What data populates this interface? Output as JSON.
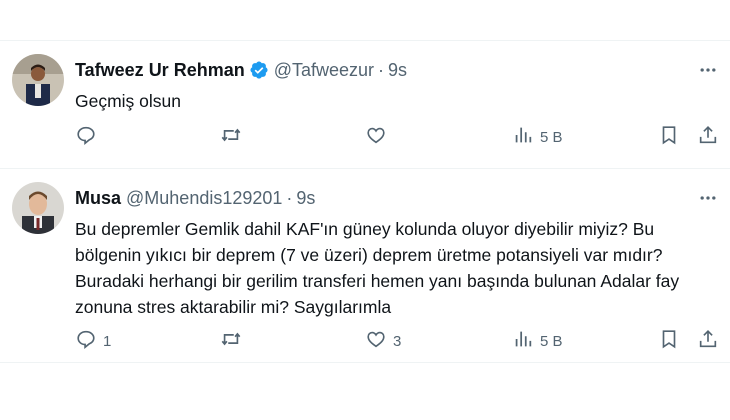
{
  "tweets": [
    {
      "name": "Tafweez Ur Rehman",
      "handle": "@Tafweezur",
      "separator": "·",
      "time": "9s",
      "text": "Geçmiş olsun",
      "verified": true,
      "reply_count": "",
      "retweet_count": "",
      "like_count": "",
      "views": "5 B",
      "icons": [
        "reply-icon",
        "retweet-icon",
        "like-icon",
        "views-icon",
        "bookmark-icon",
        "share-icon",
        "more-icon",
        "verified-badge-icon"
      ]
    },
    {
      "name": "Musa",
      "handle": "@Muhendis129201",
      "separator": "·",
      "time": "9s",
      "text": "Bu depremler Gemlik dahil KAF'ın güney kolunda oluyor diyebilir miyiz? Bu bölgenin yıkıcı bir deprem (7 ve üzeri) deprem üretme potansiyeli var mıdır? Buradaki herhangi bir gerilim transferi hemen yanı başında bulunan Adalar fay zonuna stres aktarabilir mi? Saygılarımla",
      "verified": false,
      "reply_count": "1",
      "retweet_count": "",
      "like_count": "3",
      "views": "5 B",
      "icons": [
        "reply-icon",
        "retweet-icon",
        "like-icon",
        "views-icon",
        "bookmark-icon",
        "share-icon",
        "more-icon"
      ]
    }
  ],
  "colors": {
    "text_primary": "#0f1419",
    "text_secondary": "#536471",
    "verified_blue": "#1d9bf0",
    "divider": "#eff3f4"
  }
}
